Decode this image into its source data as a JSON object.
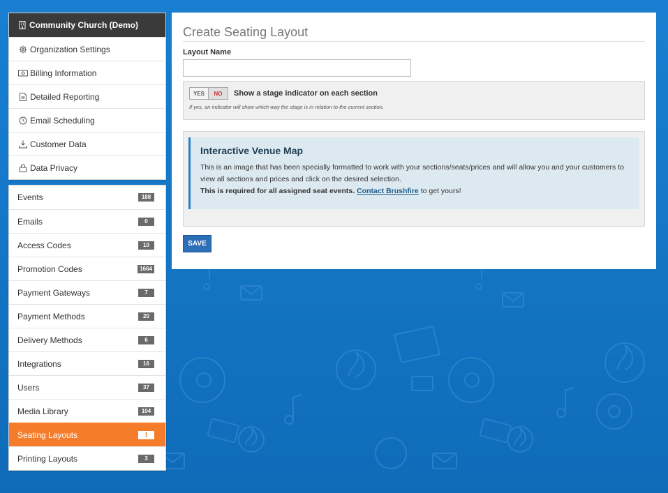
{
  "org": {
    "name": "Community Church (Demo)",
    "items": [
      {
        "label": "Organization Settings",
        "icon": "gear-icon"
      },
      {
        "label": "Billing Information",
        "icon": "money-icon"
      },
      {
        "label": "Detailed Reporting",
        "icon": "document-icon"
      },
      {
        "label": "Email Scheduling",
        "icon": "clock-icon"
      },
      {
        "label": "Customer Data",
        "icon": "download-icon"
      },
      {
        "label": "Data Privacy",
        "icon": "lock-icon"
      }
    ]
  },
  "nav": {
    "items": [
      {
        "label": "Events",
        "count": "188"
      },
      {
        "label": "Emails",
        "count": "0"
      },
      {
        "label": "Access Codes",
        "count": "10"
      },
      {
        "label": "Promotion Codes",
        "count": "1664"
      },
      {
        "label": "Payment Gateways",
        "count": "7"
      },
      {
        "label": "Payment Methods",
        "count": "20"
      },
      {
        "label": "Delivery Methods",
        "count": "6"
      },
      {
        "label": "Integrations",
        "count": "16"
      },
      {
        "label": "Users",
        "count": "37"
      },
      {
        "label": "Media Library",
        "count": "104"
      },
      {
        "label": "Seating Layouts",
        "count": "1"
      },
      {
        "label": "Printing Layouts",
        "count": "3"
      }
    ],
    "active_color": "#f47c2a"
  },
  "main": {
    "title": "Create Seating Layout",
    "layout_name_label": "Layout Name",
    "layout_name_value": "",
    "toggle_yes": "YES",
    "toggle_no": "NO",
    "stage_label": "Show a stage indicator on each section",
    "stage_hint": "If yes, an indicator will show which way the stage is in relation to the current section.",
    "map_title": "Interactive Venue Map",
    "map_desc": "This is an image that has been specially formatted to work with your sections/seats/prices and will allow you and your customers to view all sections and prices and click on the desired selection.",
    "map_req_bold": "This is required for all assigned seat events.",
    "map_req_link": "Contact Brushfire",
    "map_req_tail": "to get yours!",
    "save_label": "SAVE"
  },
  "colors": {
    "background": "#1578c8",
    "dark_header": "#3a3a3a",
    "primary_button": "#2d6fb7"
  }
}
